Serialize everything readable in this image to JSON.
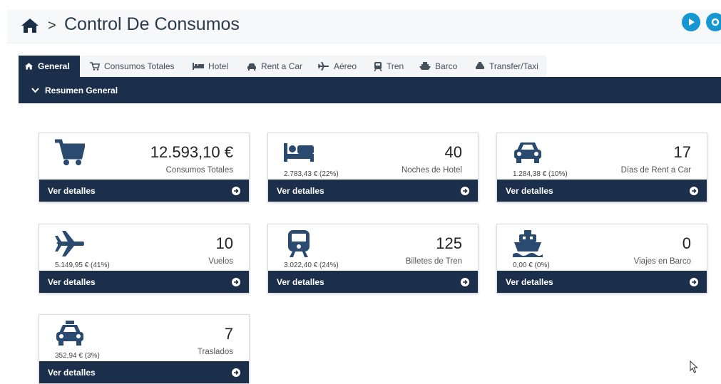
{
  "header": {
    "separator": ">",
    "title": "Control De Consumos"
  },
  "tabs": [
    {
      "label": "General",
      "icon": "home-icon"
    },
    {
      "label": "Consumos Totales",
      "icon": "cart-icon"
    },
    {
      "label": "Hotel",
      "icon": "bed-icon"
    },
    {
      "label": "Rent a Car",
      "icon": "car-icon"
    },
    {
      "label": "Aéreo",
      "icon": "plane-icon"
    },
    {
      "label": "Tren",
      "icon": "train-icon"
    },
    {
      "label": "Barco",
      "icon": "ship-icon"
    },
    {
      "label": "Transfer/Taxi",
      "icon": "taxi-icon"
    }
  ],
  "section": {
    "title": "Resumen General"
  },
  "cards": [
    {
      "icon": "cart-icon",
      "value": "12.593,10 €",
      "label": "Consumos Totales",
      "sub": "",
      "link": "Ver detalles"
    },
    {
      "icon": "bed-icon",
      "value": "40",
      "label": "Noches de Hotel",
      "sub": "2.783,43 €  (22%)",
      "link": "Ver detalles"
    },
    {
      "icon": "car-icon",
      "value": "17",
      "label": "Días de Rent a Car",
      "sub": "1.284,38 €  (10%)",
      "link": "Ver detalles"
    },
    {
      "icon": "plane-icon",
      "value": "10",
      "label": "Vuelos",
      "sub": "5.149,95 €  (41%)",
      "link": "Ver detalles"
    },
    {
      "icon": "train-icon",
      "value": "125",
      "label": "Billetes de Tren",
      "sub": "3.022,40 €  (24%)",
      "link": "Ver detalles"
    },
    {
      "icon": "ship-icon",
      "value": "0",
      "label": "Viajes en Barco",
      "sub": "0,00 €  (0%)",
      "link": "Ver detalles"
    },
    {
      "icon": "taxi-icon",
      "value": "7",
      "label": "Traslados",
      "sub": "352,94 €  (3%)",
      "link": "Ver detalles"
    }
  ],
  "colors": {
    "navy": "#1c2f4a",
    "accent": "#1797d1",
    "icon": "#2b4a6f"
  }
}
